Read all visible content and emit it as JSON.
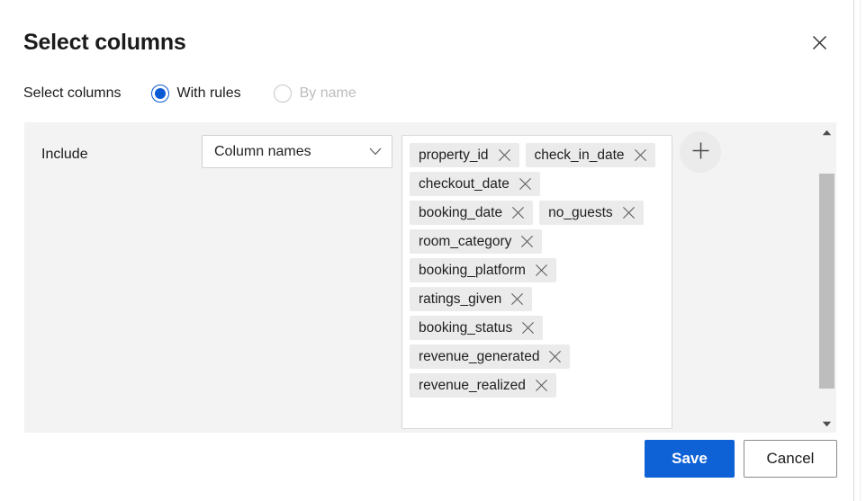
{
  "dialog": {
    "title": "Select columns",
    "close_icon": "close-icon"
  },
  "choice": {
    "label": "Select columns",
    "options": [
      {
        "label": "With rules",
        "selected": true,
        "disabled": false
      },
      {
        "label": "By name",
        "selected": false,
        "disabled": true
      }
    ]
  },
  "rule": {
    "include_label": "Include",
    "dropdown": {
      "value": "Column names",
      "chevron_icon": "chevron-down-icon"
    },
    "add_button_icon": "plus-icon",
    "tags": [
      "property_id",
      "check_in_date",
      "checkout_date",
      "booking_date",
      "no_guests",
      "room_category",
      "booking_platform",
      "ratings_given",
      "booking_status",
      "revenue_generated",
      "revenue_realized"
    ],
    "tag_remove_icon": "close-icon"
  },
  "scrollbar": {
    "up_icon": "triangle-up-icon",
    "down_icon": "triangle-down-icon"
  },
  "footer": {
    "save_label": "Save",
    "cancel_label": "Cancel"
  },
  "colors": {
    "accent": "#0f62d6",
    "radio_accent": "#0a5ad4",
    "panel_bg": "#f3f3f3",
    "tag_bg": "#ebebeb",
    "scrollbar_thumb": "#bdbdbd"
  }
}
